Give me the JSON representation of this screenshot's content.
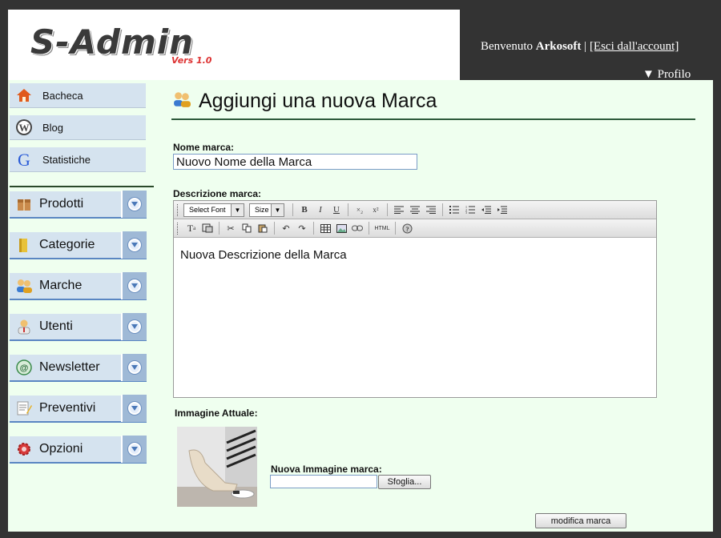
{
  "header": {
    "logo_text": "S-Admin",
    "logo_version": "Vers 1.0",
    "welcome_prefix": "Benvenuto",
    "username": "Arkosoft",
    "separator": "|",
    "logout_label": "[Esci dall'account]",
    "profile_label": "▼ Profilo"
  },
  "sidebar": {
    "top_items": [
      {
        "label": "Bacheca",
        "icon": "home-icon"
      },
      {
        "label": "Blog",
        "icon": "wordpress-icon"
      },
      {
        "label": "Statistiche",
        "icon": "google-icon"
      }
    ],
    "sections": [
      {
        "label": "Prodotti",
        "icon": "box-icon"
      },
      {
        "label": "Categorie",
        "icon": "folder-icon"
      },
      {
        "label": "Marche",
        "icon": "users-icon"
      },
      {
        "label": "Utenti",
        "icon": "user-icon"
      },
      {
        "label": "Newsletter",
        "icon": "email-icon"
      },
      {
        "label": "Preventivi",
        "icon": "note-icon"
      },
      {
        "label": "Opzioni",
        "icon": "gear-icon"
      }
    ]
  },
  "main": {
    "title": "Aggiungi una nuova Marca",
    "name_label": "Nome marca:",
    "name_value": "Nuovo Nome della Marca",
    "desc_label": "Descrizione marca:",
    "editor": {
      "font_select": "Select Font",
      "size_select": "Size",
      "html_button": "HTML",
      "content": "Nuova Descrizione della Marca"
    },
    "current_image_label": "Immagine Attuale:",
    "new_image_label": "Nuova Immagine marca:",
    "browse_label": "Sfoglia...",
    "submit_label": "modifica marca"
  },
  "colors": {
    "background": "#efffef",
    "header_dark": "#333333",
    "menu_item": "#d5e3ef",
    "menu_accent": "#5a86c2"
  }
}
